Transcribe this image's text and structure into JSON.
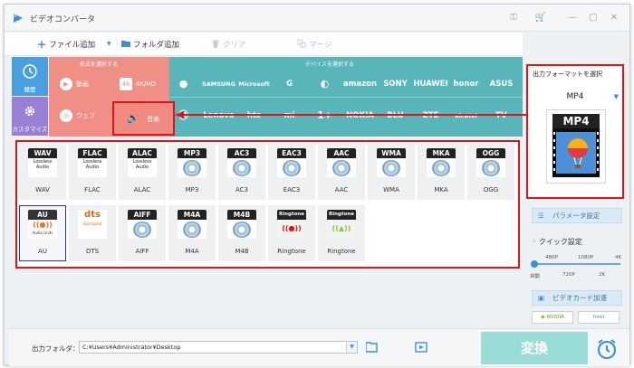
{
  "app": {
    "title": "ビデオコンバータ"
  },
  "toolbar": {
    "add_file": "ファイル追加",
    "add_folder": "フォルダ追加",
    "clear": "クリア",
    "merge": "マージ"
  },
  "sidebar": {
    "history": "履歴",
    "custom": "カスタマイズ"
  },
  "categories": {
    "section_label": "形式を選択する",
    "video": "動画",
    "hd": "4K/HD",
    "web": "ウェブ",
    "music": "音楽"
  },
  "devices": {
    "section_label": "デバイスを選択する",
    "row1": [
      "",
      "SAMSUNG",
      "Microsoft",
      "G",
      "",
      "amazon",
      "SONY",
      "HUAWEI",
      "honor",
      "ASUS"
    ],
    "row2": [
      "",
      "Lenovo",
      "htc",
      "mi",
      "",
      "NOKIA",
      "BLU",
      "ZTE",
      "alcatel",
      "TV"
    ]
  },
  "formats": [
    {
      "badge": "WAV",
      "name": "WAV",
      "kind": "lossless"
    },
    {
      "badge": "FLAC",
      "name": "FLAC",
      "kind": "lossless"
    },
    {
      "badge": "ALAC",
      "name": "ALAC",
      "kind": "lossless"
    },
    {
      "badge": "MP3",
      "name": "MP3",
      "kind": "disc"
    },
    {
      "badge": "AC3",
      "name": "AC3",
      "kind": "disc"
    },
    {
      "badge": "EAC3",
      "name": "EAC3",
      "kind": "disc"
    },
    {
      "badge": "AAC",
      "name": "AAC",
      "kind": "disc"
    },
    {
      "badge": "WMA",
      "name": "WMA",
      "kind": "disc"
    },
    {
      "badge": "MKA",
      "name": "MKA",
      "kind": "disc"
    },
    {
      "badge": "OGG",
      "name": "OGG",
      "kind": "disc"
    },
    {
      "badge": "AU",
      "name": "AU",
      "kind": "au",
      "selected": true
    },
    {
      "badge": "dts",
      "name": "DTS",
      "kind": "dts"
    },
    {
      "badge": "AIFF",
      "name": "AIFF",
      "kind": "disc"
    },
    {
      "badge": "M4A",
      "name": "M4A",
      "kind": "disc"
    },
    {
      "badge": "M4B",
      "name": "M4B",
      "kind": "disc"
    },
    {
      "badge": "Ringtone",
      "name": "Ringtone",
      "kind": "apple"
    },
    {
      "badge": "Ringtone",
      "name": "Ringtone",
      "kind": "android"
    }
  ],
  "lossless_text": "Lossless Audio",
  "au_sub": "Audio Units",
  "dts_sub": "Surround",
  "output_panel": {
    "header": "出力フォーマットを選択",
    "selected": "MP4",
    "art_label": "MP4"
  },
  "parameters": "パラメータ設定",
  "quick": {
    "title": "クイック設定",
    "top_marks": [
      "480P",
      "1080P",
      "4K"
    ],
    "bottom_marks": [
      "自動",
      "720P",
      "2K"
    ]
  },
  "gpu": {
    "label": "ビデオカード加速",
    "nvidia": "NVIDIA",
    "intel": "Intel"
  },
  "output": {
    "label": "出力フォルダ：",
    "path": "C:¥Users¥Administrator¥Desktop"
  },
  "convert": "変換",
  "colors": {
    "accent_red": "#e0131a",
    "coral": "#ef8f85",
    "teal": "#58b5b9",
    "blue": "#3a8fd8",
    "convert": "#9adcd8"
  }
}
